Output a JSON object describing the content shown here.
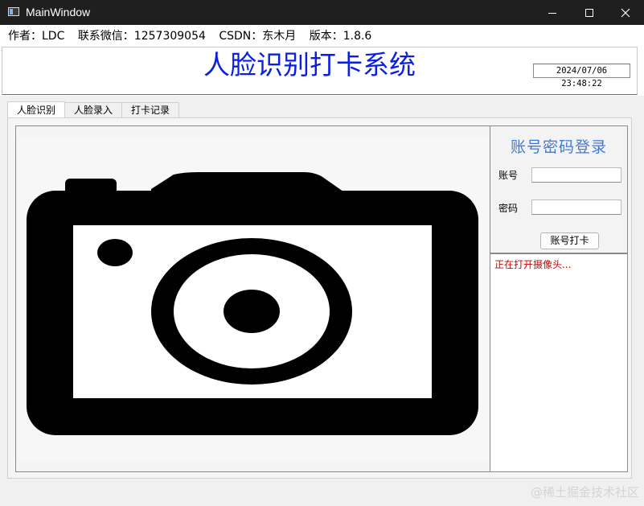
{
  "window": {
    "title": "MainWindow",
    "minimize_glyph": "minimize-icon",
    "maximize_glyph": "maximize-icon",
    "close_glyph": "close-icon"
  },
  "info": {
    "author": "作者：LDC",
    "wechat": "联系微信：1257309054",
    "csdn": "CSDN：东木月",
    "version": "版本：1.8.6"
  },
  "header": {
    "title": "人脸识别打卡系统",
    "datetime": "2024/07/06 23:48:22"
  },
  "tabs": [
    {
      "label": "人脸识别",
      "active": true
    },
    {
      "label": "人脸录入",
      "active": false
    },
    {
      "label": "打卡记录",
      "active": false
    }
  ],
  "camera": {
    "icon": "camera-icon"
  },
  "login": {
    "title": "账号密码登录",
    "account_label": "账号",
    "account_value": "",
    "password_label": "密码",
    "password_value": "",
    "button_label": "账号打卡"
  },
  "log": {
    "message": "正在打开摄像头..."
  },
  "watermark": "@稀土掘金技术社区",
  "colors": {
    "title": "#0a1ee6",
    "login_title": "#3f7ad6",
    "log_text": "#cc0000",
    "header_underline": "#2a7ad8"
  }
}
